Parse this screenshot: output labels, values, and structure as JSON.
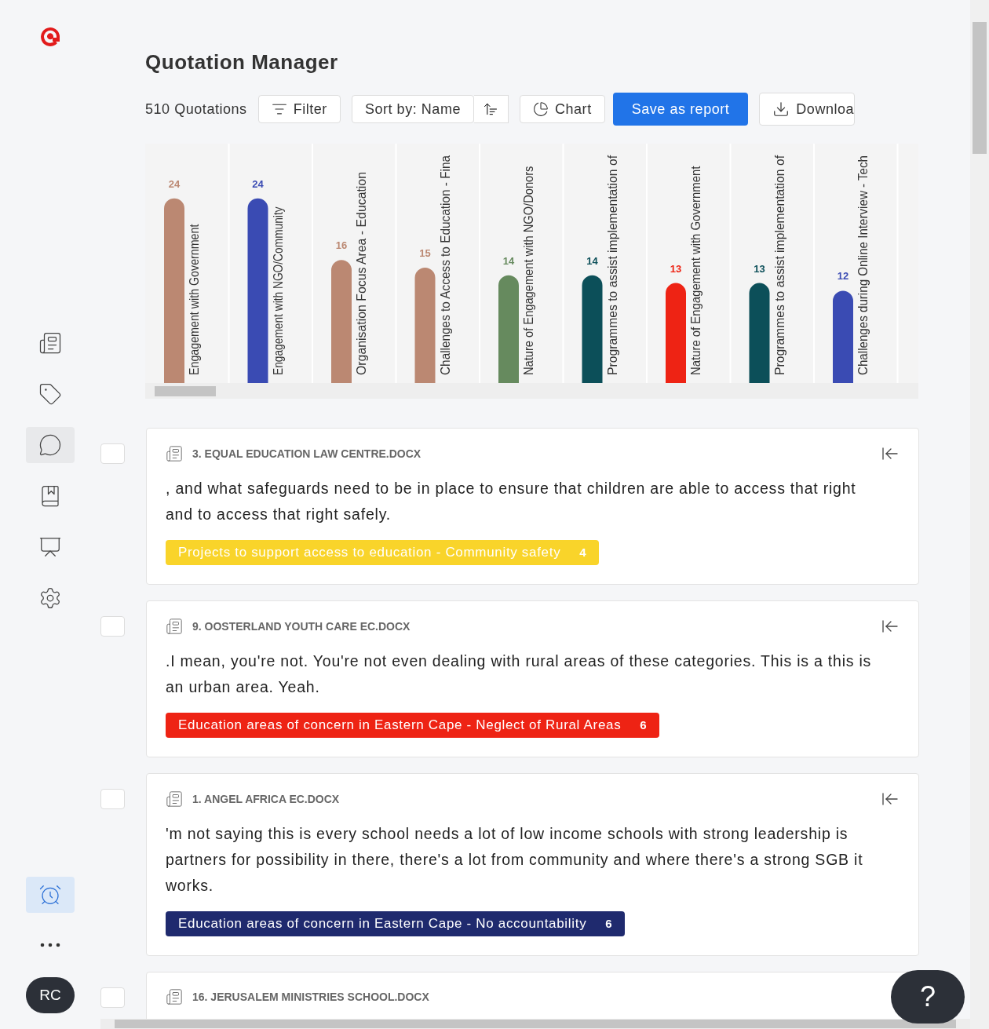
{
  "sidebar": {
    "items": [
      {
        "kind": "document",
        "selected": false
      },
      {
        "kind": "tag",
        "selected": false
      },
      {
        "kind": "quote",
        "selected": true
      },
      {
        "kind": "book",
        "selected": false
      },
      {
        "kind": "presentation",
        "selected": false
      },
      {
        "kind": "settings",
        "selected": false
      }
    ],
    "bottom_items": [
      {
        "kind": "alarm",
        "selected": true
      },
      {
        "kind": "more",
        "selected": false
      }
    ],
    "avatar": "RC"
  },
  "title": "Quotation Manager",
  "toolbar": {
    "count": "510 Quotations",
    "filter": "Filter",
    "sort": "Sort by: Name",
    "chart": "Chart",
    "save": "Save as report",
    "download": "Downloa"
  },
  "chart_data": {
    "type": "bar",
    "data_labels": true,
    "categories": [
      "Engagement with Government",
      "Engagement with NGO/Community",
      "Organisation Focus Area - Education",
      "Challenges to Access to Education - Fina",
      "Nature of Engagement with NGO/Donors",
      "Programmes to assist implementation of",
      "Nature of Engagement with Government",
      "Programmes to assist implementation of",
      "Challenges during Online Interview - Tech"
    ],
    "values": [
      24,
      24,
      16,
      15,
      14,
      14,
      13,
      13,
      12
    ],
    "colors": [
      "#bb8872",
      "#3a4bb3",
      "#bb8872",
      "#bb8872",
      "#668a5e",
      "#0c4f59",
      "#ee2314",
      "#0c4f59",
      "#3a4bb3"
    ]
  },
  "quotations": [
    {
      "checked": false,
      "file": "3. EQUAL EDUCATION LAW CENTRE.DOCX",
      "text": ", and what safeguards need to be in place to ensure that children are able to access that right and to access that right safely.",
      "tag": {
        "label": "Projects to support access to education - Community safety",
        "count": "4",
        "color": "#f9d42a"
      }
    },
    {
      "checked": false,
      "file": "9. OOSTERLAND YOUTH CARE EC.DOCX",
      "text": ".I mean, you're not. You're not even dealing with rural areas of these categories. This is a this is an urban area. Yeah.",
      "tag": {
        "label": "Education areas of concern in Eastern Cape - Neglect of Rural Areas",
        "count": "6",
        "color": "#ee2314"
      }
    },
    {
      "checked": false,
      "file": "1. ANGEL AFRICA EC.DOCX",
      "text": "'m not saying this is every school needs a lot of low income schools with strong leadership is partners for possibility in there, there's a lot from community and where there's a strong SGB it works.",
      "tag": {
        "label": "Education areas of concern in Eastern Cape - No accountability",
        "count": "6",
        "color": "#1f2a6e"
      }
    },
    {
      "checked": false,
      "file": "16. JERUSALEM MINISTRIES SCHOOL.DOCX"
    }
  ],
  "help": "?"
}
